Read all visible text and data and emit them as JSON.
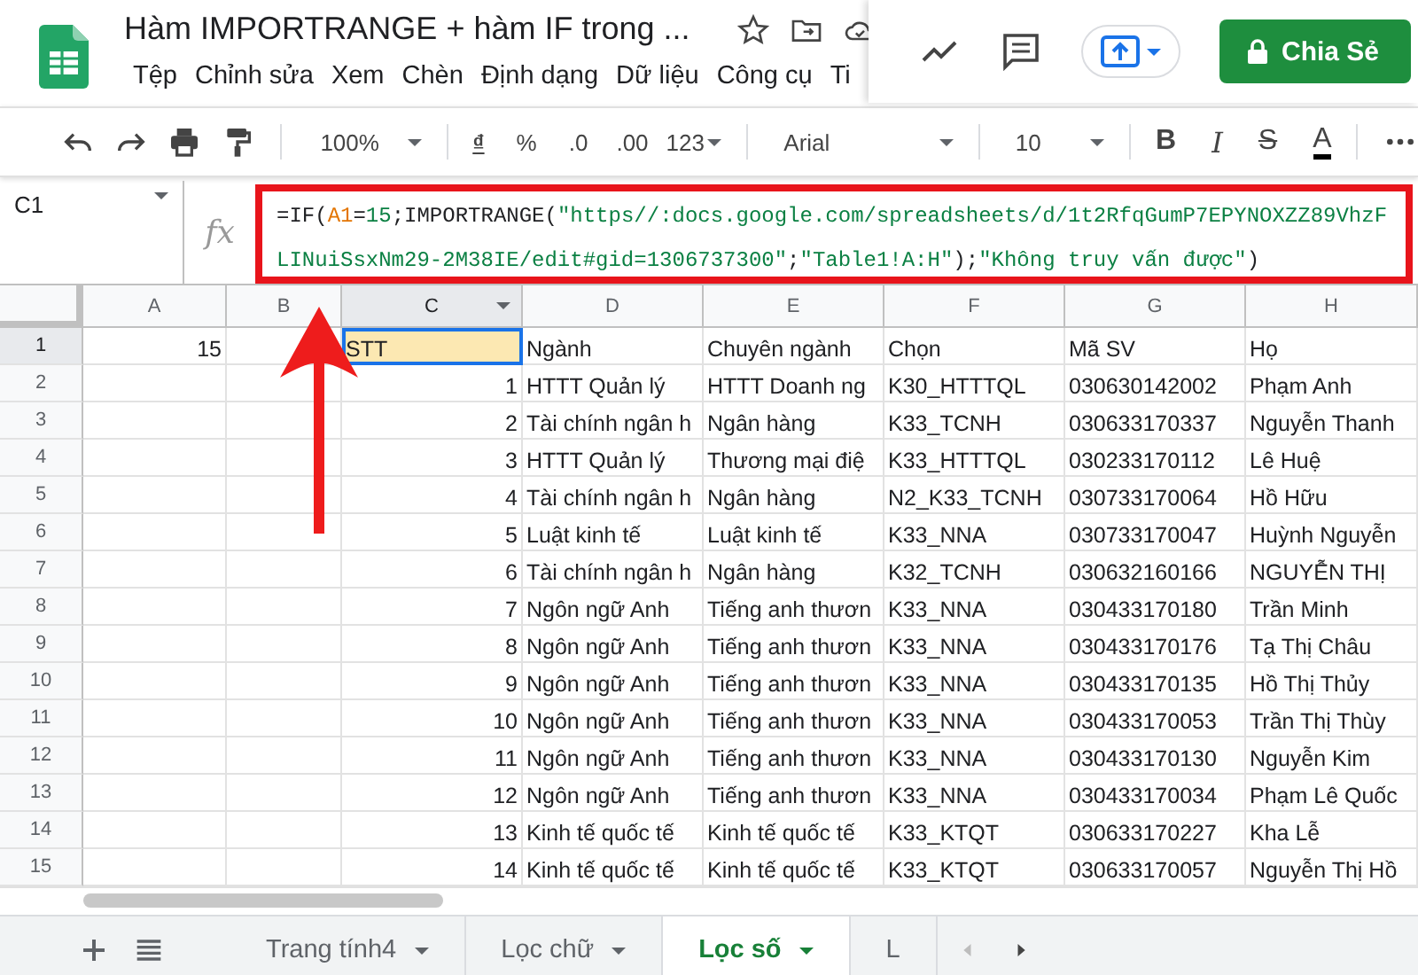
{
  "header": {
    "title": "Hàm IMPORTRANGE + hàm IF trong ...",
    "menu": [
      "Tệp",
      "Chỉnh sửa",
      "Xem",
      "Chèn",
      "Định dạng",
      "Dữ liệu",
      "Công cụ",
      "Ti"
    ],
    "share_button": "Chia Sẻ"
  },
  "toolbar": {
    "zoom": "100%",
    "currency": "₫",
    "percent": "%",
    "decrease_decimals": ".0",
    "increase_decimals": ".00",
    "number_format": "123",
    "font": "Arial",
    "font_size": "10",
    "bold": "B",
    "italic": "I",
    "strikethrough": "S",
    "text_color": "A"
  },
  "formula_bar": {
    "cell": "C1",
    "fx_label": "fx",
    "formula": [
      {
        "kind": "plain",
        "text": "=IF("
      },
      {
        "kind": "ref",
        "text": "A1"
      },
      {
        "kind": "plain",
        "text": "="
      },
      {
        "kind": "number",
        "text": "15"
      },
      {
        "kind": "plain",
        "text": ";IMPORTRANGE("
      },
      {
        "kind": "string",
        "text": "\"https//:docs.google.com/spreadsheets/d/1t2RfqGumP7EPYNOXZZ89VhzFLINuiSsxNm29-2M38IE/edit#gid=1306737300\""
      },
      {
        "kind": "plain",
        "text": ";"
      },
      {
        "kind": "string",
        "text": "\"Table1!A:H\""
      },
      {
        "kind": "plain",
        "text": ");"
      },
      {
        "kind": "string",
        "text": "\"Không truy vấn được\""
      },
      {
        "kind": "plain",
        "text": ")"
      }
    ]
  },
  "columns": [
    {
      "label": "A",
      "kind": "number",
      "selected": false
    },
    {
      "label": "B",
      "kind": "text",
      "selected": false
    },
    {
      "label": "C",
      "kind": "number",
      "selected": true
    },
    {
      "label": "D",
      "kind": "text",
      "selected": false
    },
    {
      "label": "E",
      "kind": "text",
      "selected": false
    },
    {
      "label": "F",
      "kind": "text",
      "selected": false
    },
    {
      "label": "G",
      "kind": "text",
      "selected": false
    },
    {
      "label": "H",
      "kind": "text",
      "selected": false
    }
  ],
  "rows": [
    {
      "number": "1",
      "selected": true,
      "cells": {
        "A": "15",
        "C": "STT",
        "D": "Ngành",
        "E": "Chuyên ngành",
        "F": "Chọn",
        "G": "Mã SV",
        "H": "Họ"
      }
    },
    {
      "number": "2",
      "selected": false,
      "cells": {
        "C": "1",
        "D": "HTTT Quản lý",
        "E": "HTTT Doanh ng",
        "F": "K30_HTTTQL",
        "G": "030630142002",
        "H": "Phạm Anh"
      }
    },
    {
      "number": "3",
      "selected": false,
      "cells": {
        "C": "2",
        "D": "Tài chính ngân h",
        "E": "Ngân hàng",
        "F": "K33_TCNH",
        "G": "030633170337",
        "H": "Nguyễn Thanh"
      }
    },
    {
      "number": "4",
      "selected": false,
      "cells": {
        "C": "3",
        "D": "HTTT Quản lý",
        "E": "Thương mại điệ",
        "F": "K33_HTTTQL",
        "G": "030233170112",
        "H": "Lê Huệ"
      }
    },
    {
      "number": "5",
      "selected": false,
      "cells": {
        "C": "4",
        "D": "Tài chính ngân h",
        "E": "Ngân hàng",
        "F": "N2_K33_TCNH",
        "G": "030733170064",
        "H": "Hồ Hữu"
      }
    },
    {
      "number": "6",
      "selected": false,
      "cells": {
        "C": "5",
        "D": "Luật kinh tế",
        "E": "Luật kinh tế",
        "F": "K33_NNA",
        "G": "030733170047",
        "H": "Huỳnh Nguyễn"
      }
    },
    {
      "number": "7",
      "selected": false,
      "cells": {
        "C": "6",
        "D": "Tài chính ngân h",
        "E": "Ngân hàng",
        "F": "K32_TCNH",
        "G": "030632160166",
        "H": "NGUYỄN THỊ"
      }
    },
    {
      "number": "8",
      "selected": false,
      "cells": {
        "C": "7",
        "D": "Ngôn ngữ Anh",
        "E": "Tiếng anh thươn",
        "F": "K33_NNA",
        "G": "030433170180",
        "H": "Trần Minh"
      }
    },
    {
      "number": "9",
      "selected": false,
      "cells": {
        "C": "8",
        "D": "Ngôn ngữ Anh",
        "E": "Tiếng anh thươn",
        "F": "K33_NNA",
        "G": "030433170176",
        "H": "Tạ Thị Châu"
      }
    },
    {
      "number": "10",
      "selected": false,
      "cells": {
        "C": "9",
        "D": "Ngôn ngữ Anh",
        "E": "Tiếng anh thươn",
        "F": "K33_NNA",
        "G": "030433170135",
        "H": "Hồ Thị Thủy"
      }
    },
    {
      "number": "11",
      "selected": false,
      "cells": {
        "C": "10",
        "D": "Ngôn ngữ Anh",
        "E": "Tiếng anh thươn",
        "F": "K33_NNA",
        "G": "030433170053",
        "H": "Trần Thị Thùy"
      }
    },
    {
      "number": "12",
      "selected": false,
      "cells": {
        "C": "11",
        "D": "Ngôn ngữ Anh",
        "E": "Tiếng anh thươn",
        "F": "K33_NNA",
        "G": "030433170130",
        "H": "Nguyễn Kim"
      }
    },
    {
      "number": "13",
      "selected": false,
      "cells": {
        "C": "12",
        "D": "Ngôn ngữ Anh",
        "E": "Tiếng anh thươn",
        "F": "K33_NNA",
        "G": "030433170034",
        "H": "Phạm Lê Quốc"
      }
    },
    {
      "number": "14",
      "selected": false,
      "cells": {
        "C": "13",
        "D": "Kinh tế quốc tế",
        "E": "Kinh tế quốc tế",
        "F": "K33_KTQT",
        "G": "030633170227",
        "H": "Kha Lễ"
      }
    },
    {
      "number": "15",
      "selected": false,
      "cells": {
        "C": "14",
        "D": "Kinh tế quốc tế",
        "E": "Kinh tế quốc tế",
        "F": "K33_KTQT",
        "G": "030633170057",
        "H": "Nguyễn Thị Hồ"
      }
    }
  ],
  "sheet_tabs": [
    {
      "label": "Trang tính4",
      "selected": false
    },
    {
      "label": "Lọc chữ",
      "selected": false
    },
    {
      "label": "Lọc số",
      "selected": true
    },
    {
      "label": "L",
      "selected": false
    }
  ]
}
